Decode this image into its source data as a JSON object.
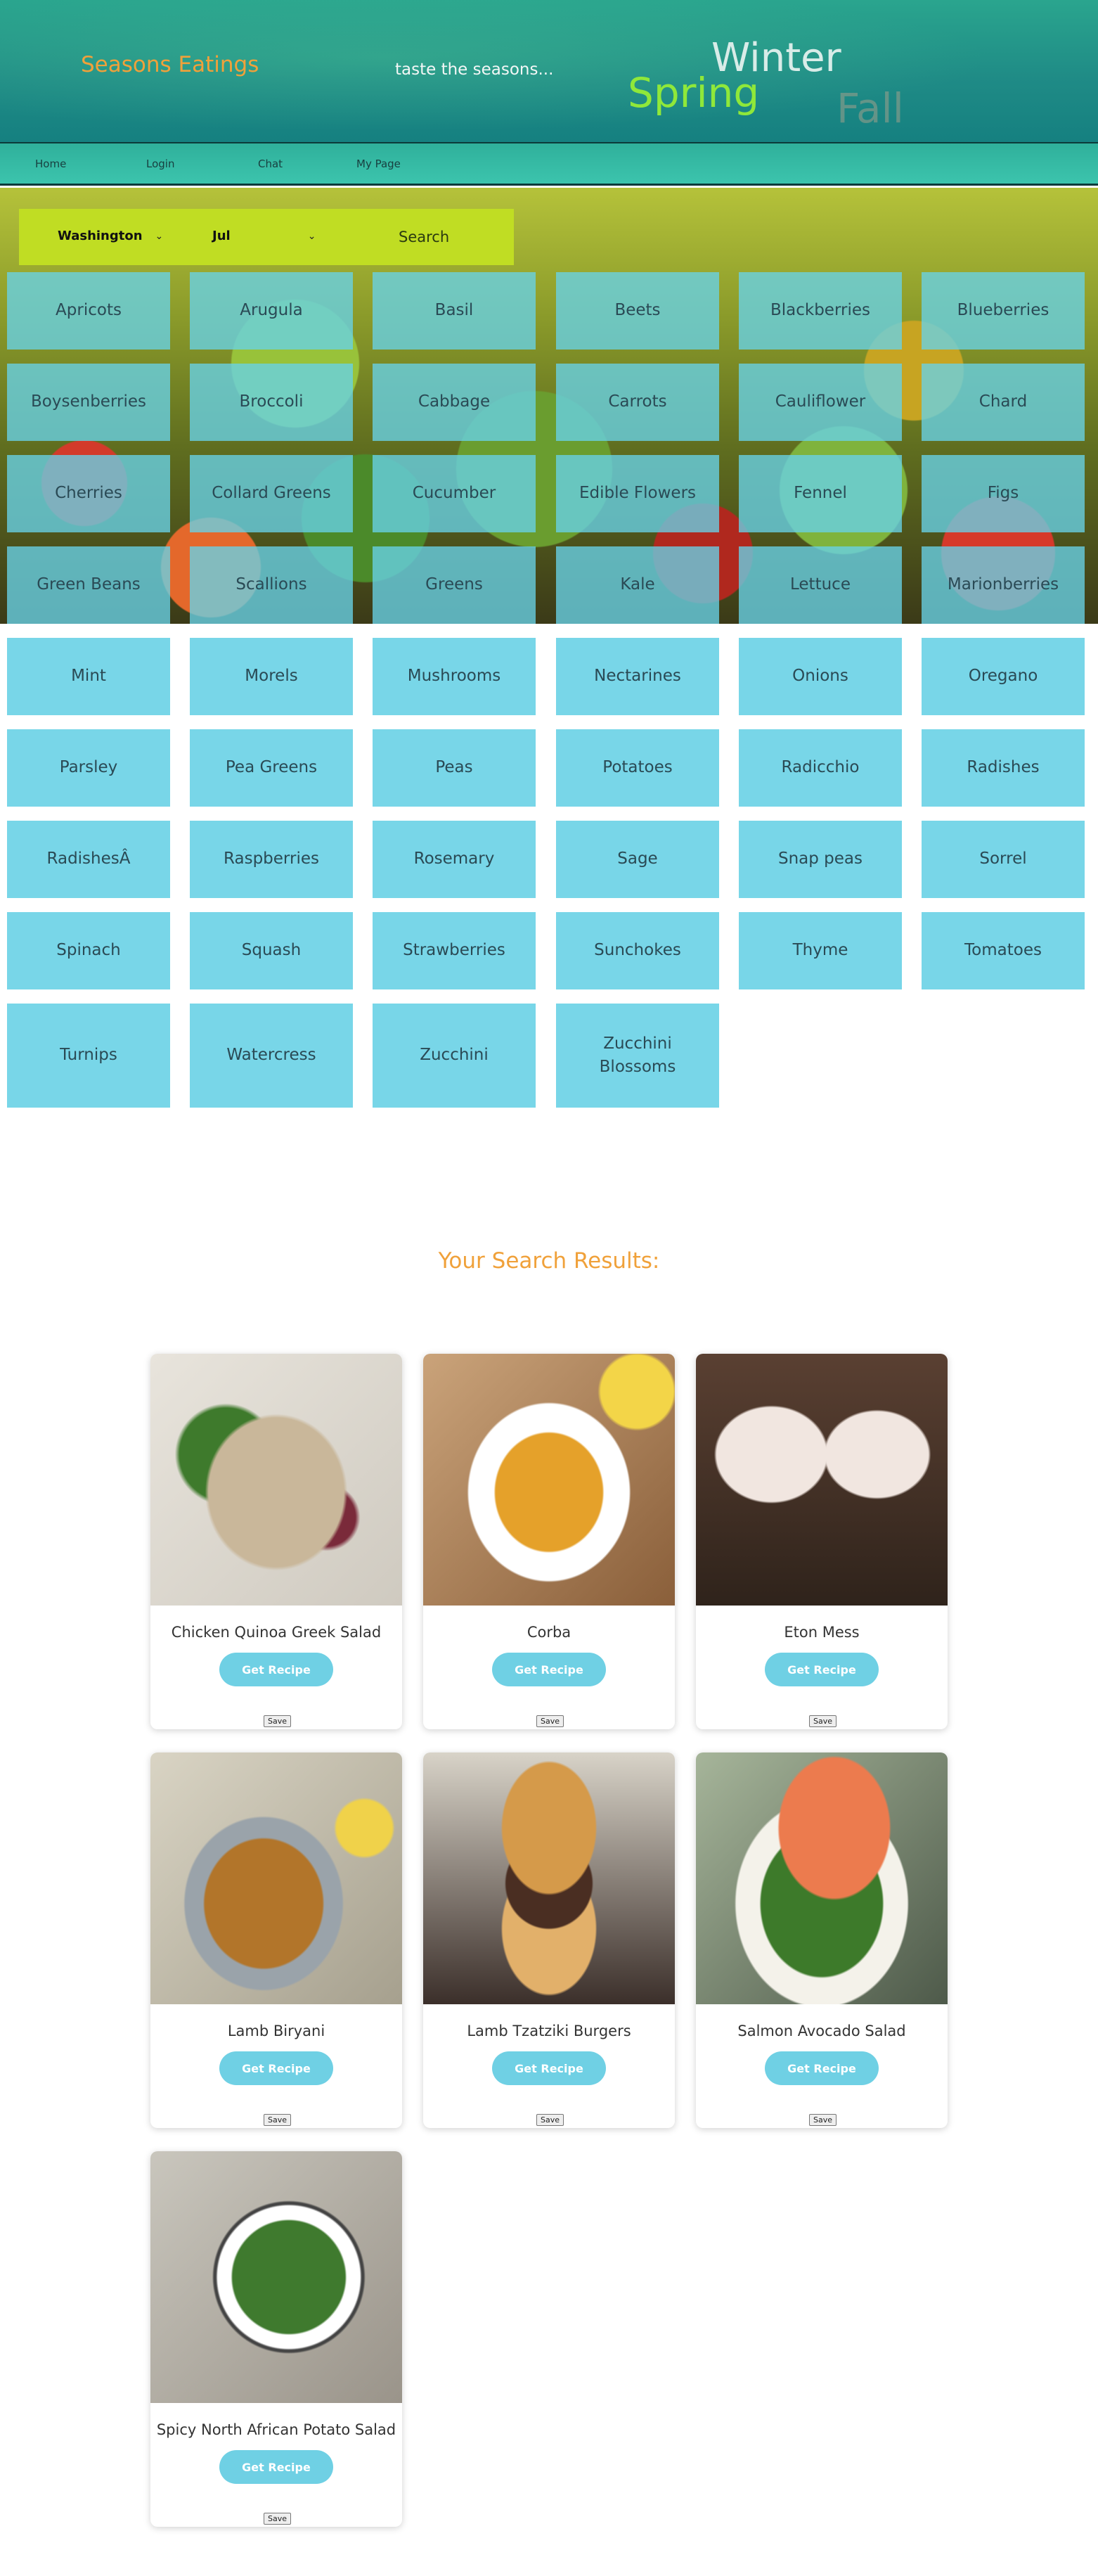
{
  "header": {
    "brand": "Seasons Eatings",
    "tagline": "taste the seasons...",
    "seasons": {
      "winter": "Winter",
      "spring": "Spring",
      "fall": "Fall"
    }
  },
  "nav": {
    "items": [
      "Home",
      "Login",
      "Chat",
      "My Page"
    ]
  },
  "search": {
    "state": "Washington",
    "month": "Jul",
    "button": "Search"
  },
  "produce": [
    "Apricots",
    "Arugula",
    "Basil",
    "Beets",
    "Blackberries",
    "Blueberries",
    "Boysenberries",
    "Broccoli",
    "Cabbage",
    "Carrots",
    "Cauliflower",
    "Chard",
    "Cherries",
    "Collard Greens",
    "Cucumber",
    "Edible Flowers",
    "Fennel",
    "Figs",
    "Green Beans",
    "Scallions",
    "Greens",
    "Kale",
    "Lettuce",
    "Marionberries",
    "Mint",
    "Morels",
    "Mushrooms",
    "Nectarines",
    "Onions",
    "Oregano",
    "Parsley",
    "Pea Greens",
    "Peas",
    "Potatoes",
    "Radicchio",
    "Radishes",
    "RadishesÂ",
    "Raspberries",
    "Rosemary",
    "Sage",
    "Snap peas",
    "Sorrel",
    "Spinach",
    "Squash",
    "Strawberries",
    "Sunchokes",
    "Thyme",
    "Tomatoes",
    "Turnips",
    "Watercress",
    "Zucchini",
    "Zucchini Blossoms"
  ],
  "results": {
    "title": "Your Search Results:",
    "recipe_button": "Get Recipe",
    "save_button": "Save",
    "cards": [
      {
        "title": "Chicken Quinoa Greek Salad"
      },
      {
        "title": "Corba"
      },
      {
        "title": "Eton Mess"
      },
      {
        "title": "Lamb Biryani"
      },
      {
        "title": "Lamb Tzatziki Burgers"
      },
      {
        "title": "Salmon Avocado Salad"
      },
      {
        "title": "Spicy North African Potato Salad"
      }
    ]
  },
  "colors": {
    "brand": "#f0a13a",
    "spring": "#8fe83a",
    "tile": "#78d6e8",
    "search_bar": "#c0dd23",
    "recipe_button": "#6fd0e4"
  }
}
